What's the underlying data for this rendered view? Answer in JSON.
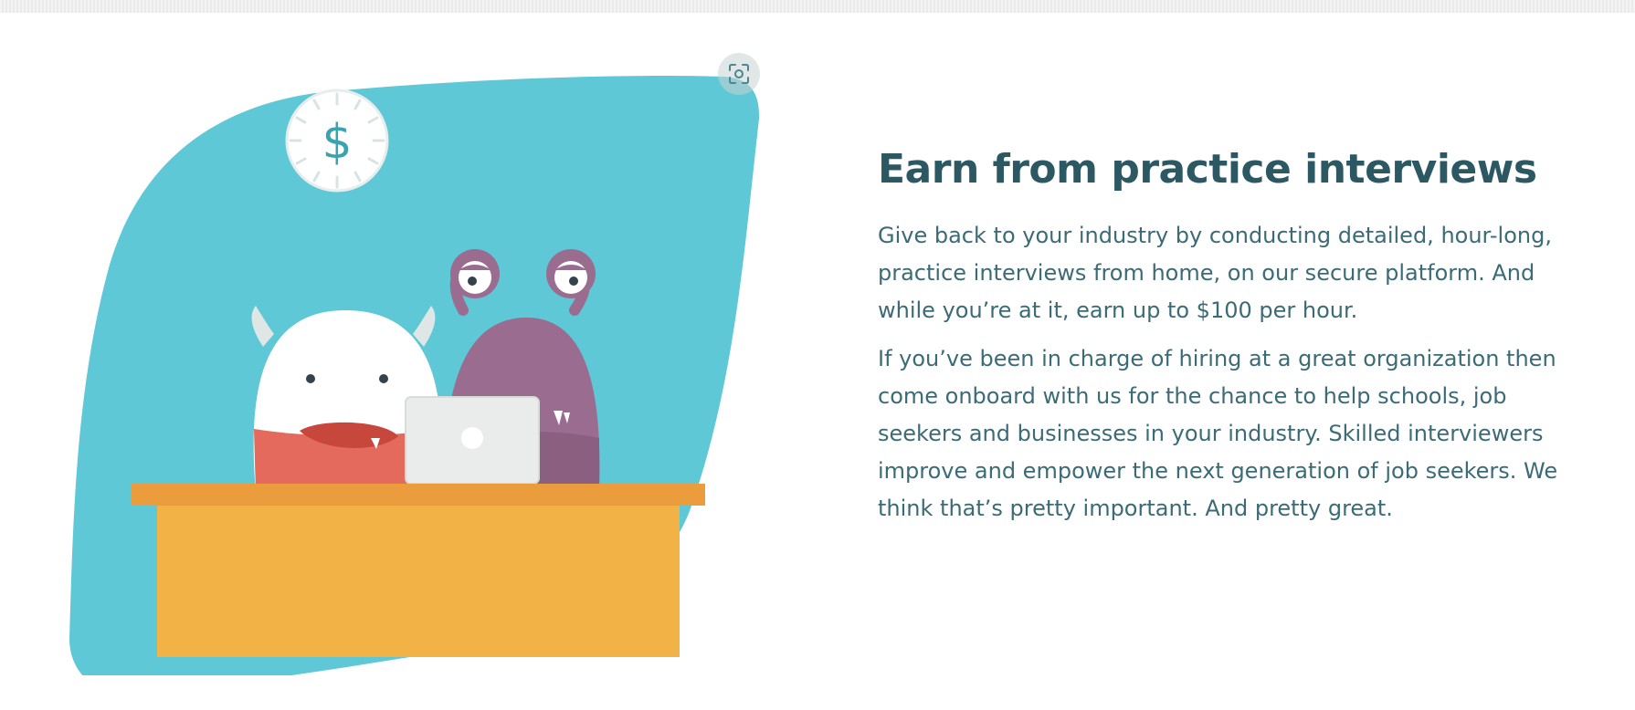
{
  "section": {
    "title": "Earn from practice interviews",
    "paragraphs": [
      "Give back to your industry by conducting detailed, hour-long, practice interviews from home, on our secure platform. And while you’re at it, earn up to $100 per hour.",
      "If you’ve been in charge of hiring at a great organization then come onboard with us for the chance to help schools, job seekers and businesses in your industry. Skilled interviewers improve and empower the next generation of job seekers. We think that’s pretty important. And pretty great."
    ]
  },
  "illustration": {
    "clock_symbol": "$",
    "colors": {
      "background_blob": "#5fc8d6",
      "desk_top": "#eb9d3d",
      "desk_body": "#f2b246",
      "purple_monster": "#9a6d90",
      "white_monster": "#ffffff",
      "white_monster_shirt": "#e36a5c",
      "laptop": "#e9ecea",
      "title_text": "#2b5863",
      "body_text": "#3b6b76"
    },
    "icons": [
      "lens-scan-icon",
      "dollar-clock-icon"
    ]
  }
}
